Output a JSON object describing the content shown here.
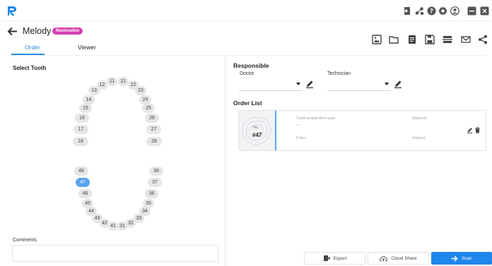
{
  "header": {
    "patient_name": "Melody",
    "status_badge": "Restoration"
  },
  "tabs": [
    {
      "label": "Order",
      "active": true
    },
    {
      "label": "Viewer",
      "active": false
    }
  ],
  "select_tooth": {
    "title": "Select Tooth",
    "selected": "47",
    "upper": [
      "11",
      "12",
      "13",
      "14",
      "15",
      "16",
      "17",
      "18",
      "21",
      "22",
      "23",
      "24",
      "25",
      "26",
      "27",
      "28"
    ],
    "lower": [
      "31",
      "32",
      "33",
      "34",
      "35",
      "36",
      "37",
      "38",
      "41",
      "42",
      "43",
      "44",
      "45",
      "46",
      "47",
      "48"
    ]
  },
  "comments": {
    "label": "Comments",
    "value": ""
  },
  "responsible": {
    "title": "Responsible",
    "doctor_label": "Doctor",
    "doctor_value": "",
    "technician_label": "Technician",
    "technician_value": ""
  },
  "order_list": {
    "title": "Order List",
    "items": [
      {
        "no_label": "No.",
        "tooth_number": "#47",
        "prep_type_label": "Tooth preparation type:",
        "prep_type_value": "-",
        "material_label": "Material:",
        "color_label": "Color:",
        "implant_label": "Implant:"
      }
    ]
  },
  "buttons": {
    "export": "Export",
    "cloud_share": "Cloud Share",
    "scan": "Scan"
  },
  "colors": {
    "accent": "#1f87ec",
    "badge": "#d63fae",
    "selected_tooth": "#5aa5ee"
  }
}
